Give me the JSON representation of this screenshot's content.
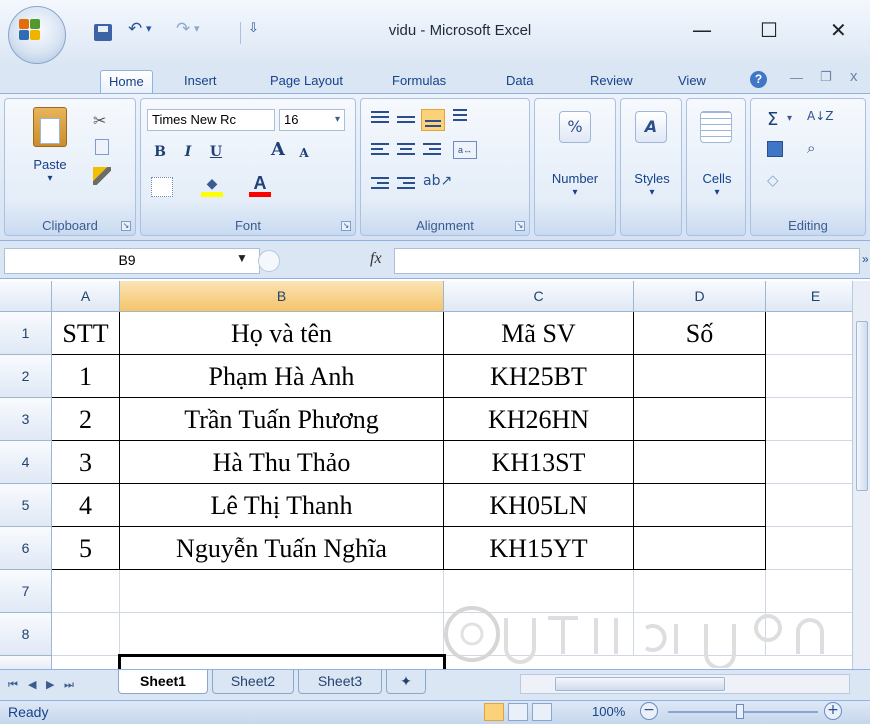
{
  "window": {
    "title": "vidu - Microsoft Excel",
    "controls": {
      "minimize": "—",
      "maximize": "☐",
      "close": "✕"
    }
  },
  "quick_access": {
    "undo": "↶",
    "redo": "↷",
    "more": "▾",
    "sep_caret": "⇩"
  },
  "ribbon_tabs": [
    "Home",
    "Insert",
    "Page Layout",
    "Formulas",
    "Data",
    "Review",
    "View"
  ],
  "ribbon_right": {
    "help": "?",
    "minimize": "—",
    "restore": "❐",
    "close": "x"
  },
  "groups": {
    "clipboard": {
      "label": "Clipboard",
      "paste": "Paste"
    },
    "font": {
      "label": "Font",
      "font_name": "Times New Rc",
      "font_size": "16",
      "bold": "B",
      "italic": "I",
      "underline": "U",
      "grow": "A",
      "shrink": "A"
    },
    "alignment": {
      "label": "Alignment"
    },
    "number": {
      "label": "Number",
      "icon": "%"
    },
    "styles": {
      "label": "Styles",
      "icon": "A"
    },
    "cells": {
      "label": "Cells"
    },
    "editing": {
      "label": "Editing",
      "sum": "Σ",
      "sort": "A↓Z",
      "find": "🔭"
    }
  },
  "formula_bar": {
    "name_box": "B9",
    "fx": "fx",
    "value": ""
  },
  "columns": [
    "A",
    "B",
    "C",
    "D",
    "E"
  ],
  "rows": [
    {
      "num": "1",
      "cells": [
        "STT",
        "Họ và tên",
        "Mã SV",
        "Số",
        ""
      ]
    },
    {
      "num": "2",
      "cells": [
        "1",
        "Phạm Hà Anh",
        "KH25BT",
        "",
        ""
      ]
    },
    {
      "num": "3",
      "cells": [
        "2",
        "Trần Tuấn Phương",
        "KH26HN",
        "",
        ""
      ]
    },
    {
      "num": "4",
      "cells": [
        "3",
        "Hà Thu Thảo",
        "KH13ST",
        "",
        ""
      ]
    },
    {
      "num": "5",
      "cells": [
        "4",
        "Lê Thị Thanh",
        "KH05LN",
        "",
        ""
      ]
    },
    {
      "num": "6",
      "cells": [
        "5",
        "Nguyễn Tuấn Nghĩa",
        "KH15YT",
        "",
        ""
      ]
    },
    {
      "num": "7",
      "cells": [
        "",
        "",
        "",
        "",
        ""
      ]
    },
    {
      "num": "8",
      "cells": [
        "",
        "",
        "",
        "",
        ""
      ]
    }
  ],
  "sheet_tabs": [
    "Sheet1",
    "Sheet2",
    "Sheet3"
  ],
  "active_sheet": "Sheet1",
  "status": {
    "text": "Ready",
    "zoom": "100%"
  },
  "colors": {
    "ribbon_blue": "#dbe6f4",
    "selected_col": "#f5c46a",
    "accent_text": "#15428b"
  }
}
